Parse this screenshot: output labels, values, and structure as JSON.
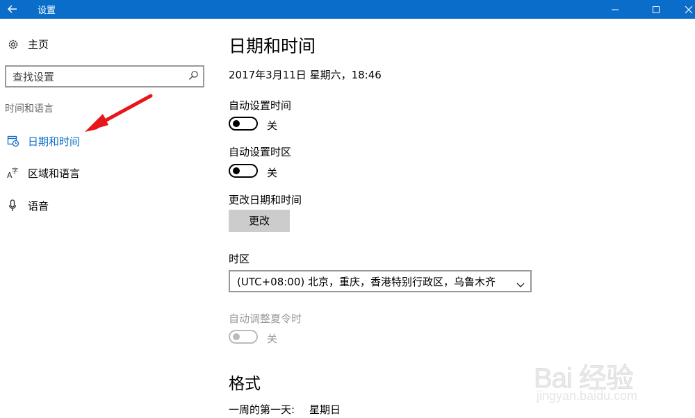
{
  "window": {
    "title": "设置"
  },
  "sidebar": {
    "home_label": "主页",
    "search_placeholder": "查找设置",
    "section_label": "时间和语言",
    "items": [
      {
        "label": "日期和时间",
        "icon": "calendar-clock-icon",
        "active": true
      },
      {
        "label": "区域和语言",
        "icon": "language-icon",
        "active": false
      },
      {
        "label": "语音",
        "icon": "microphone-icon",
        "active": false
      }
    ]
  },
  "main": {
    "title": "日期和时间",
    "current_datetime": "2017年3月11日 星期六，18:46",
    "auto_time": {
      "label": "自动设置时间",
      "state": "关",
      "on": false
    },
    "auto_timezone": {
      "label": "自动设置时区",
      "state": "关",
      "on": false
    },
    "change_datetime": {
      "label": "更改日期和时间",
      "button": "更改"
    },
    "timezone": {
      "label": "时区",
      "value": "(UTC+08:00) 北京，重庆，香港特别行政区，乌鲁木齐"
    },
    "dst": {
      "label": "自动调整夏令时",
      "state": "关",
      "on": false,
      "disabled": true
    },
    "format": {
      "title": "格式",
      "first_day_label": "一周的第一天:",
      "first_day_value": "星期日"
    }
  },
  "watermark": {
    "main": "Bai 经验",
    "sub": "jingyan.baidu.com"
  },
  "colors": {
    "accent": "#0a6dc9",
    "annotation_arrow": "#e8161b"
  }
}
